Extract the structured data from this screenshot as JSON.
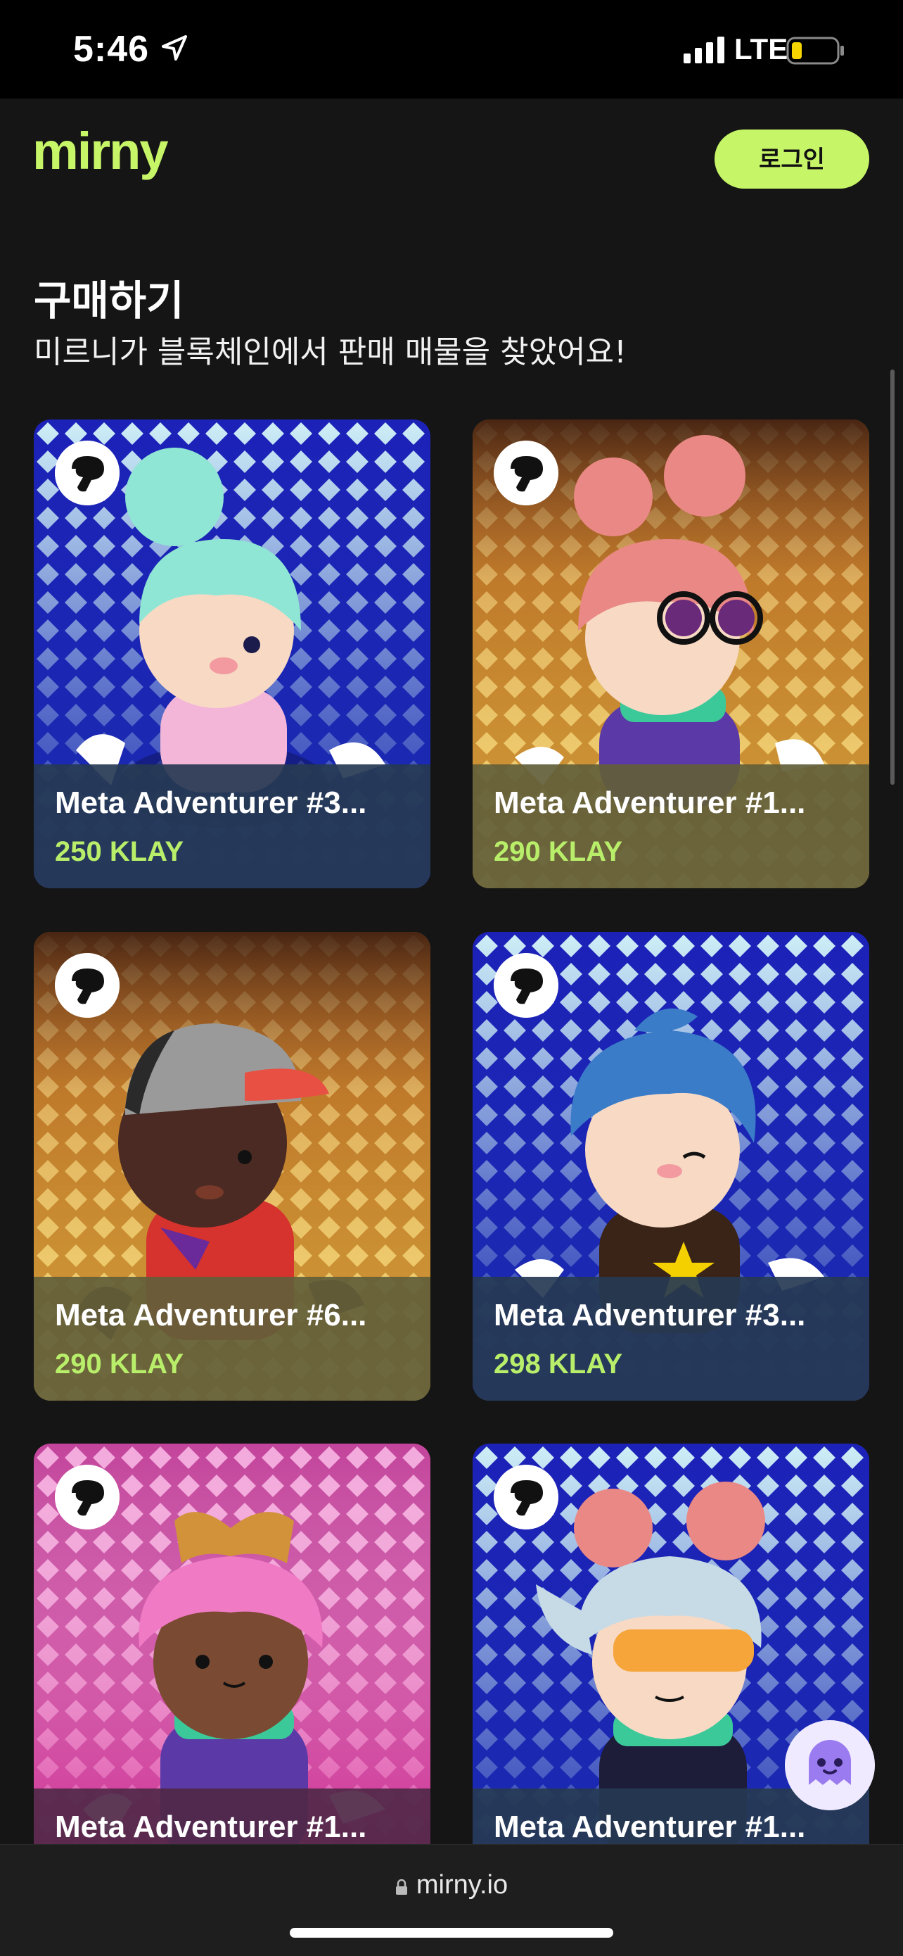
{
  "status_bar": {
    "time": "5:46",
    "network": "LTE",
    "location_icon": "location-arrow-icon",
    "signal_icon": "signal-bars-icon",
    "battery_icon": "battery-low-icon"
  },
  "header": {
    "logo_text": "mirny",
    "login_label": "로그인"
  },
  "page": {
    "title": "구매하기",
    "subtitle": "미르니가 블록체인에서 판매 매물을 찾았어요!"
  },
  "listings": [
    {
      "name": "Meta Adventurer #3...",
      "price": "250 KLAY",
      "bg": "blue"
    },
    {
      "name": "Meta Adventurer #1...",
      "price": "290 KLAY",
      "bg": "orange"
    },
    {
      "name": "Meta Adventurer #6...",
      "price": "290 KLAY",
      "bg": "orange"
    },
    {
      "name": "Meta Adventurer #3...",
      "price": "298 KLAY",
      "bg": "blue"
    },
    {
      "name": "Meta Adventurer #1...",
      "price": "",
      "bg": "pink"
    },
    {
      "name": "Meta Adventurer #1...",
      "price": "",
      "bg": "blue"
    }
  ],
  "browser": {
    "url": "mirny.io"
  },
  "colors": {
    "accent": "#c6f567",
    "price": "#b8ee6a",
    "background": "#151515"
  }
}
